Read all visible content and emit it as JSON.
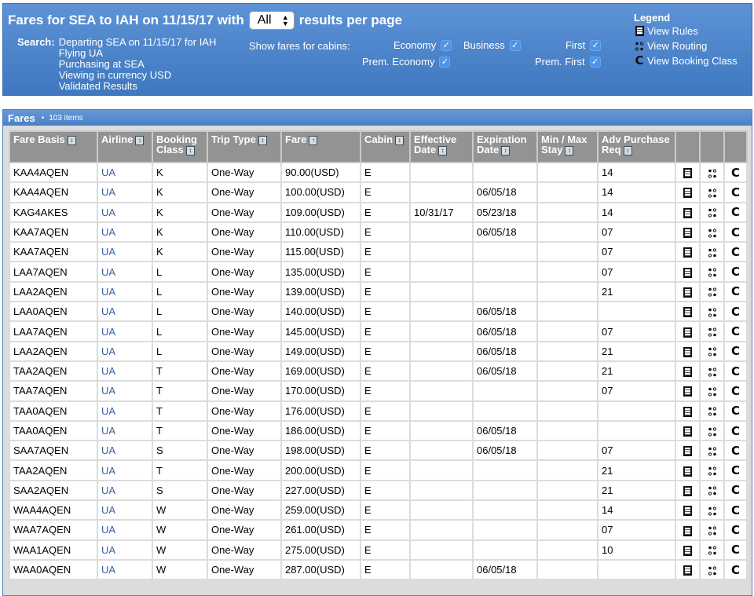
{
  "header": {
    "title_prefix": "Fares for SEA to IAH on 11/15/17 with",
    "results_per_page": "All",
    "title_suffix": "results per page",
    "search_label": "Search:",
    "search_lines": [
      "Departing SEA on 11/15/17 for IAH",
      "Flying UA",
      "Purchasing at SEA",
      "Viewing in currency USD",
      "Validated Results"
    ],
    "cabins_label": "Show fares for cabins:",
    "cabins": [
      {
        "label": "Economy",
        "checked": true
      },
      {
        "label": "Business",
        "checked": true
      },
      {
        "label": "First",
        "checked": true
      },
      {
        "label": "Prem. Economy",
        "checked": true
      },
      {
        "label": "Prem. First",
        "checked": true
      }
    ],
    "check_glyph": "✓",
    "legend": {
      "title": "Legend",
      "items": [
        {
          "icon": "rules-icon",
          "label": "View Rules"
        },
        {
          "icon": "routing-icon",
          "label": "View Routing"
        },
        {
          "icon": "booking-class-icon",
          "label": "View Booking Class"
        }
      ]
    }
  },
  "fares": {
    "title": "Fares",
    "bullet": "•",
    "count": "103 items",
    "columns": [
      {
        "line1": "Fare Basis",
        "line2": "",
        "sort": "both"
      },
      {
        "line1": "Airline",
        "line2": "",
        "sort": "both"
      },
      {
        "line1": "Booking",
        "line2": "Class",
        "sort": "both"
      },
      {
        "line1": "Trip Type",
        "line2": "",
        "sort": "both"
      },
      {
        "line1": "Fare",
        "line2": "",
        "sort": "asc"
      },
      {
        "line1": "Cabin",
        "line2": "",
        "sort": "both"
      },
      {
        "line1": "Effective",
        "line2": "Date",
        "sort": "both"
      },
      {
        "line1": "Expiration",
        "line2": "Date",
        "sort": "both"
      },
      {
        "line1": "Min / Max",
        "line2": "Stay",
        "sort": "both"
      },
      {
        "line1": "Adv Purchase",
        "line2": "Req",
        "sort": "both"
      }
    ],
    "sort_glyphs": {
      "both": "↕",
      "asc": "↑"
    },
    "booking_class_glyph": "C",
    "rows": [
      {
        "fare_basis": "KAA4AQEN",
        "airline": "UA",
        "booking_class": "K",
        "trip_type": "One-Way",
        "fare": "90.00(USD)",
        "cabin": "E",
        "effective": "",
        "expiration": "",
        "stay": "",
        "adv": "14"
      },
      {
        "fare_basis": "KAA4AQEN",
        "airline": "UA",
        "booking_class": "K",
        "trip_type": "One-Way",
        "fare": "100.00(USD)",
        "cabin": "E",
        "effective": "",
        "expiration": "06/05/18",
        "stay": "",
        "adv": "14"
      },
      {
        "fare_basis": "KAG4AKES",
        "airline": "UA",
        "booking_class": "K",
        "trip_type": "One-Way",
        "fare": "109.00(USD)",
        "cabin": "E",
        "effective": "10/31/17",
        "expiration": "05/23/18",
        "stay": "",
        "adv": "14"
      },
      {
        "fare_basis": "KAA7AQEN",
        "airline": "UA",
        "booking_class": "K",
        "trip_type": "One-Way",
        "fare": "110.00(USD)",
        "cabin": "E",
        "effective": "",
        "expiration": "06/05/18",
        "stay": "",
        "adv": "07"
      },
      {
        "fare_basis": "KAA7AQEN",
        "airline": "UA",
        "booking_class": "K",
        "trip_type": "One-Way",
        "fare": "115.00(USD)",
        "cabin": "E",
        "effective": "",
        "expiration": "",
        "stay": "",
        "adv": "07"
      },
      {
        "fare_basis": "LAA7AQEN",
        "airline": "UA",
        "booking_class": "L",
        "trip_type": "One-Way",
        "fare": "135.00(USD)",
        "cabin": "E",
        "effective": "",
        "expiration": "",
        "stay": "",
        "adv": "07"
      },
      {
        "fare_basis": "LAA2AQEN",
        "airline": "UA",
        "booking_class": "L",
        "trip_type": "One-Way",
        "fare": "139.00(USD)",
        "cabin": "E",
        "effective": "",
        "expiration": "",
        "stay": "",
        "adv": "21"
      },
      {
        "fare_basis": "LAA0AQEN",
        "airline": "UA",
        "booking_class": "L",
        "trip_type": "One-Way",
        "fare": "140.00(USD)",
        "cabin": "E",
        "effective": "",
        "expiration": "06/05/18",
        "stay": "",
        "adv": ""
      },
      {
        "fare_basis": "LAA7AQEN",
        "airline": "UA",
        "booking_class": "L",
        "trip_type": "One-Way",
        "fare": "145.00(USD)",
        "cabin": "E",
        "effective": "",
        "expiration": "06/05/18",
        "stay": "",
        "adv": "07"
      },
      {
        "fare_basis": "LAA2AQEN",
        "airline": "UA",
        "booking_class": "L",
        "trip_type": "One-Way",
        "fare": "149.00(USD)",
        "cabin": "E",
        "effective": "",
        "expiration": "06/05/18",
        "stay": "",
        "adv": "21"
      },
      {
        "fare_basis": "TAA2AQEN",
        "airline": "UA",
        "booking_class": "T",
        "trip_type": "One-Way",
        "fare": "169.00(USD)",
        "cabin": "E",
        "effective": "",
        "expiration": "06/05/18",
        "stay": "",
        "adv": "21"
      },
      {
        "fare_basis": "TAA7AQEN",
        "airline": "UA",
        "booking_class": "T",
        "trip_type": "One-Way",
        "fare": "170.00(USD)",
        "cabin": "E",
        "effective": "",
        "expiration": "",
        "stay": "",
        "adv": "07"
      },
      {
        "fare_basis": "TAA0AQEN",
        "airline": "UA",
        "booking_class": "T",
        "trip_type": "One-Way",
        "fare": "176.00(USD)",
        "cabin": "E",
        "effective": "",
        "expiration": "",
        "stay": "",
        "adv": ""
      },
      {
        "fare_basis": "TAA0AQEN",
        "airline": "UA",
        "booking_class": "T",
        "trip_type": "One-Way",
        "fare": "186.00(USD)",
        "cabin": "E",
        "effective": "",
        "expiration": "06/05/18",
        "stay": "",
        "adv": ""
      },
      {
        "fare_basis": "SAA7AQEN",
        "airline": "UA",
        "booking_class": "S",
        "trip_type": "One-Way",
        "fare": "198.00(USD)",
        "cabin": "E",
        "effective": "",
        "expiration": "06/05/18",
        "stay": "",
        "adv": "07"
      },
      {
        "fare_basis": "TAA2AQEN",
        "airline": "UA",
        "booking_class": "T",
        "trip_type": "One-Way",
        "fare": "200.00(USD)",
        "cabin": "E",
        "effective": "",
        "expiration": "",
        "stay": "",
        "adv": "21"
      },
      {
        "fare_basis": "SAA2AQEN",
        "airline": "UA",
        "booking_class": "S",
        "trip_type": "One-Way",
        "fare": "227.00(USD)",
        "cabin": "E",
        "effective": "",
        "expiration": "",
        "stay": "",
        "adv": "21"
      },
      {
        "fare_basis": "WAA4AQEN",
        "airline": "UA",
        "booking_class": "W",
        "trip_type": "One-Way",
        "fare": "259.00(USD)",
        "cabin": "E",
        "effective": "",
        "expiration": "",
        "stay": "",
        "adv": "14"
      },
      {
        "fare_basis": "WAA7AQEN",
        "airline": "UA",
        "booking_class": "W",
        "trip_type": "One-Way",
        "fare": "261.00(USD)",
        "cabin": "E",
        "effective": "",
        "expiration": "",
        "stay": "",
        "adv": "07"
      },
      {
        "fare_basis": "WAA1AQEN",
        "airline": "UA",
        "booking_class": "W",
        "trip_type": "One-Way",
        "fare": "275.00(USD)",
        "cabin": "E",
        "effective": "",
        "expiration": "",
        "stay": "",
        "adv": "10"
      },
      {
        "fare_basis": "WAA0AQEN",
        "airline": "UA",
        "booking_class": "W",
        "trip_type": "One-Way",
        "fare": "287.00(USD)",
        "cabin": "E",
        "effective": "",
        "expiration": "06/05/18",
        "stay": "",
        "adv": ""
      }
    ]
  }
}
